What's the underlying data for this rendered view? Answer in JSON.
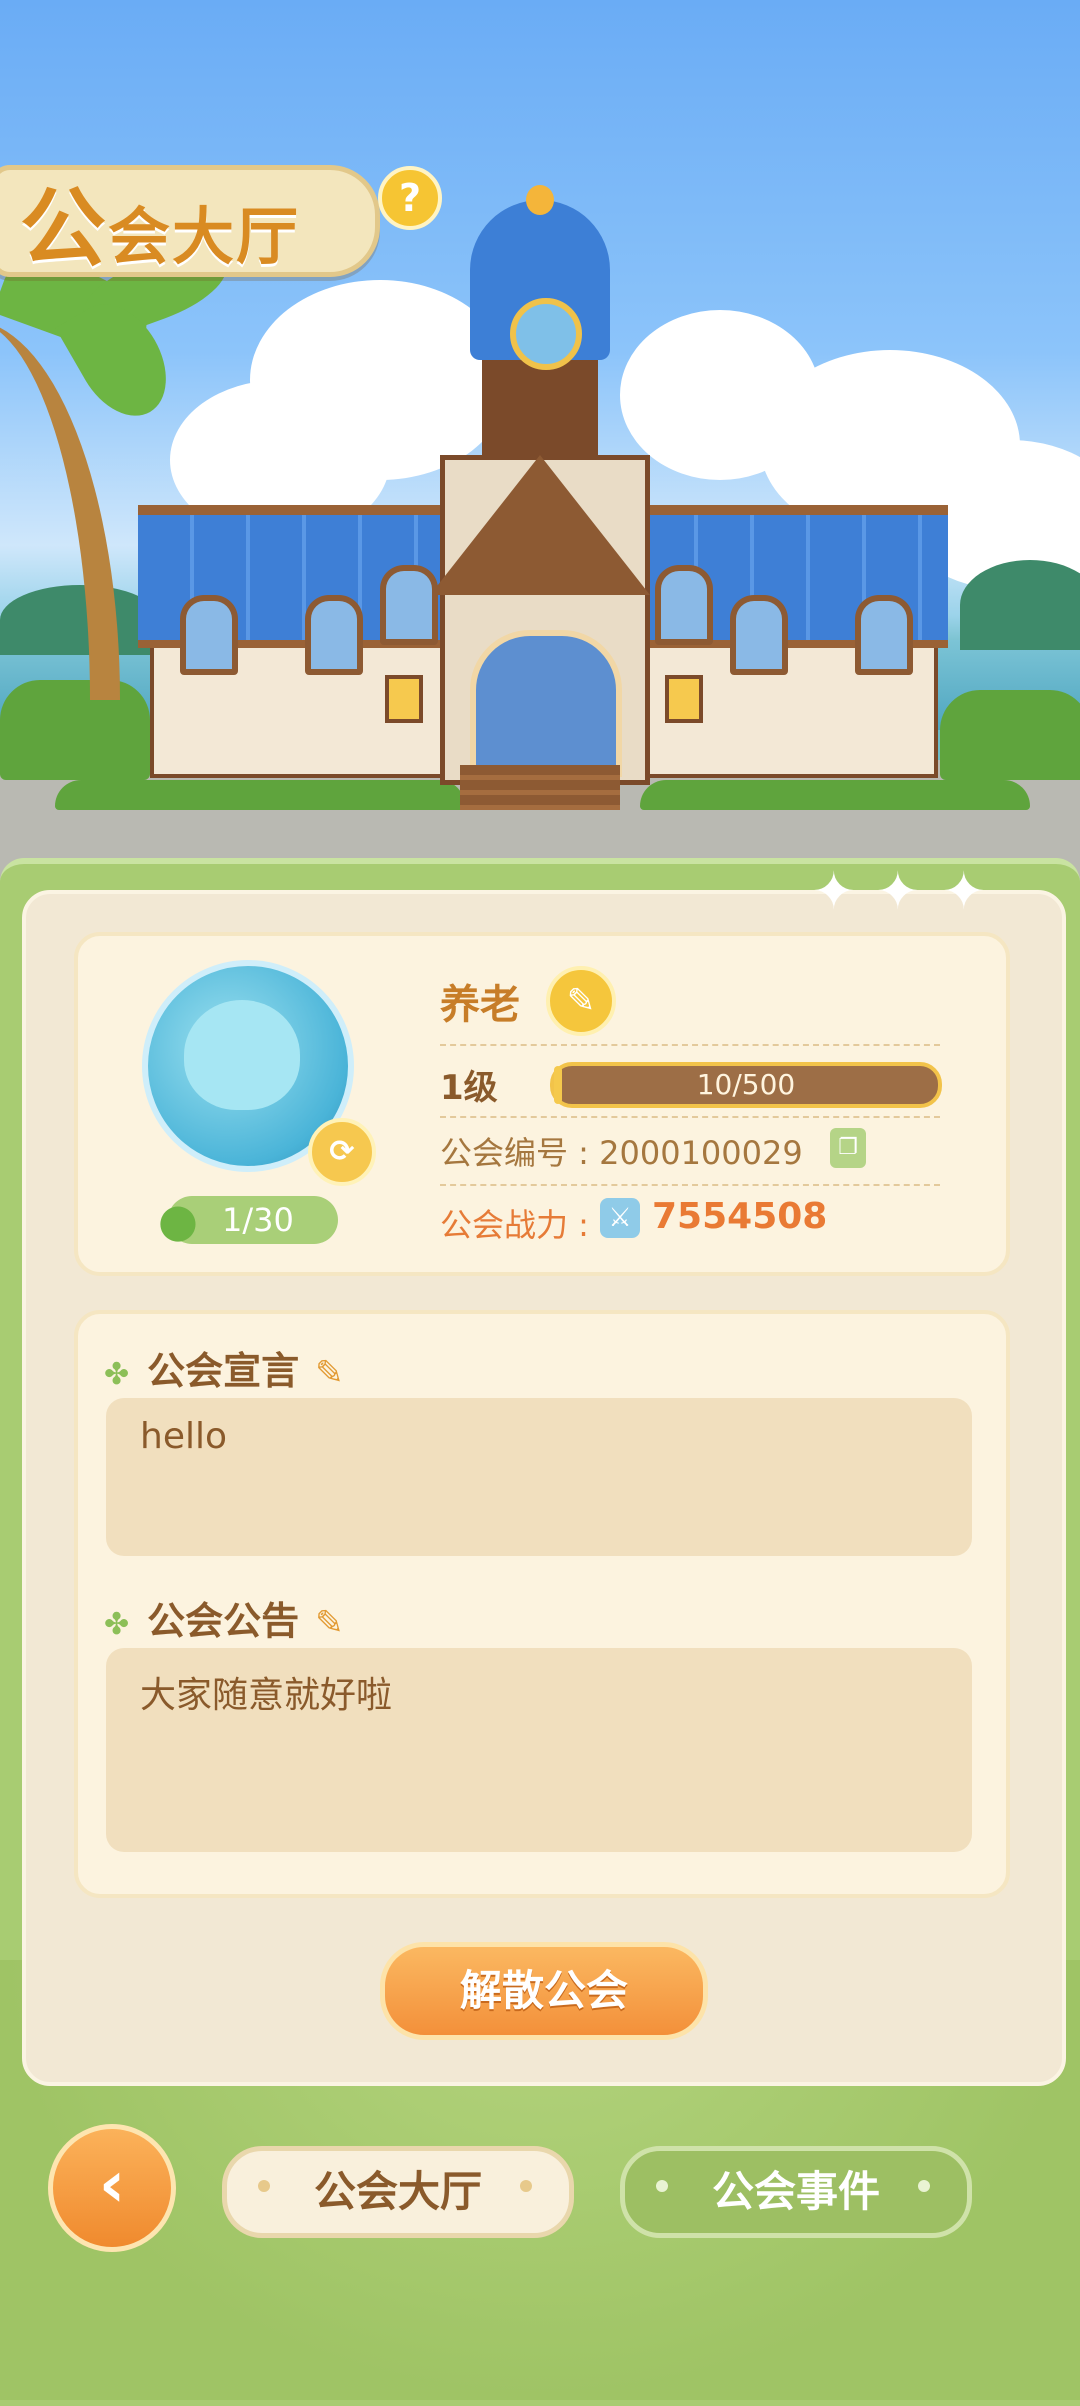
{
  "header": {
    "title_first": "公",
    "title_rest": "会大厅",
    "help_label": "?"
  },
  "guild": {
    "name": "养老",
    "level_label": "1级",
    "xp_text": "10/500",
    "xp_fraction": 0.02,
    "id_label": "公会编号 : 2000100029",
    "power_label": "公会战力 :",
    "power_value": "7554508",
    "members": "1/30"
  },
  "declaration": {
    "label": "公会宣言",
    "text": "hello"
  },
  "notice": {
    "label": "公会公告",
    "text": "大家随意就好啦"
  },
  "actions": {
    "disband_label": "解散公会"
  },
  "tabs": {
    "hall_label": "公会大厅",
    "events_label": "公会事件"
  },
  "colors": {
    "accent": "#f3903a",
    "panel": "#f2e8d4",
    "frame": "#a8cc72"
  }
}
